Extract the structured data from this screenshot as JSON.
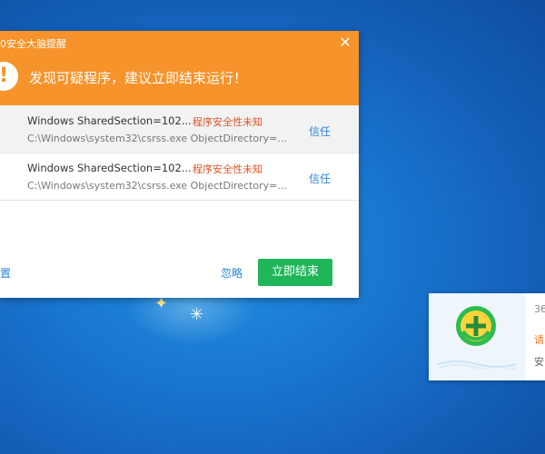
{
  "colors": {
    "header": "#f6932a",
    "primary_button": "#1fb65a",
    "link": "#2d86d8",
    "risk_text": "#e0552a"
  },
  "alert": {
    "title": "0安全大脑提醒",
    "headline": "发现可疑程序，建议立即结束运行！",
    "rows": [
      {
        "name": "Windows SharedSection=102...",
        "path": "C:\\Windows\\system32\\csrss.exe ObjectDirectory=...",
        "risk": "程序安全性未知",
        "action": "信任"
      },
      {
        "name": "Windows SharedSection=102...",
        "path": "C:\\Windows\\system32\\csrss.exe ObjectDirectory=...",
        "risk": "程序安全性未知",
        "action": "信任"
      }
    ],
    "settings_label": "置",
    "ignore_label": "忽略",
    "end_label": "立即结束"
  },
  "notify": {
    "line1": "36",
    "line2": "请",
    "line3": "安"
  }
}
